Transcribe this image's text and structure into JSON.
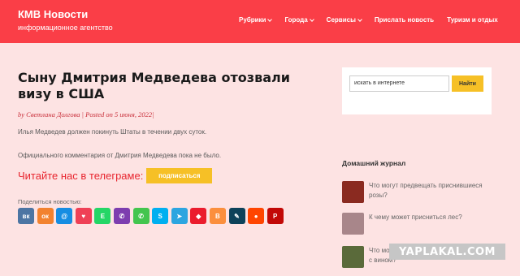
{
  "header": {
    "brand": "КМВ Новости",
    "tagline": "информационное агентство",
    "nav": [
      {
        "label": "Рубрики",
        "has_dropdown": true
      },
      {
        "label": "Города",
        "has_dropdown": true
      },
      {
        "label": "Сервисы",
        "has_dropdown": true
      },
      {
        "label": "Прислать новость",
        "has_dropdown": false
      },
      {
        "label": "Туризм и отдых",
        "has_dropdown": false
      }
    ]
  },
  "article": {
    "title": "Сыну Дмитрия Медведева отозвали визу в США",
    "meta": "by Светлана Долгова | Posted on 5 июня, 2022|",
    "para1": "Илья Медведев должен покинуть Штаты в течении двух суток.",
    "para2": "Официального комментария от Дмитрия Медведева пока не было.",
    "telegram_text": "Читайте нас в телеграме:",
    "subscribe_label": "подписаться",
    "share_label": "Поделиться новостью:"
  },
  "share_buttons": [
    {
      "name": "vk-share-icon",
      "glyph": "вк",
      "color": "#4c75a3"
    },
    {
      "name": "ok-share-icon",
      "glyph": "ок",
      "color": "#f2822f"
    },
    {
      "name": "mailru-share-icon",
      "glyph": "@",
      "color": "#168de2"
    },
    {
      "name": "pocket-share-icon",
      "glyph": "♥",
      "color": "#ef4056"
    },
    {
      "name": "evernote-share-icon",
      "glyph": "E",
      "color": "#24d666"
    },
    {
      "name": "viber-share-icon",
      "glyph": "✆",
      "color": "#7d3daf"
    },
    {
      "name": "whatsapp-share-icon",
      "glyph": "✆",
      "color": "#43c54e"
    },
    {
      "name": "skype-share-icon",
      "glyph": "S",
      "color": "#00aff0"
    },
    {
      "name": "telegram-share-icon",
      "glyph": "➤",
      "color": "#2ca5e0"
    },
    {
      "name": "collections-share-icon",
      "glyph": "◆",
      "color": "#eb1c2d"
    },
    {
      "name": "blogger-share-icon",
      "glyph": "B",
      "color": "#fb8f3d"
    },
    {
      "name": "livejournal-share-icon",
      "glyph": "✎",
      "color": "#0d425a"
    },
    {
      "name": "reddit-share-icon",
      "glyph": "●",
      "color": "#ff4500"
    },
    {
      "name": "pinterest-share-icon",
      "glyph": "P",
      "color": "#c20806"
    }
  ],
  "sidebar": {
    "search_placeholder": "искать в интернете",
    "search_button": "Найти",
    "widget_title": "Домашний журнал",
    "posts": [
      {
        "title": "Что могут предвещать приснившиеся розы?",
        "thumb_color": "#8a2a20"
      },
      {
        "title": "К чему может присниться лес?",
        "thumb_color": "#a8868a"
      },
      {
        "title": "Что может предвещать сон, связанное с вином?",
        "thumb_color": "#5a6a3a"
      }
    ]
  },
  "watermark": "YAPLAKAL.COM"
}
